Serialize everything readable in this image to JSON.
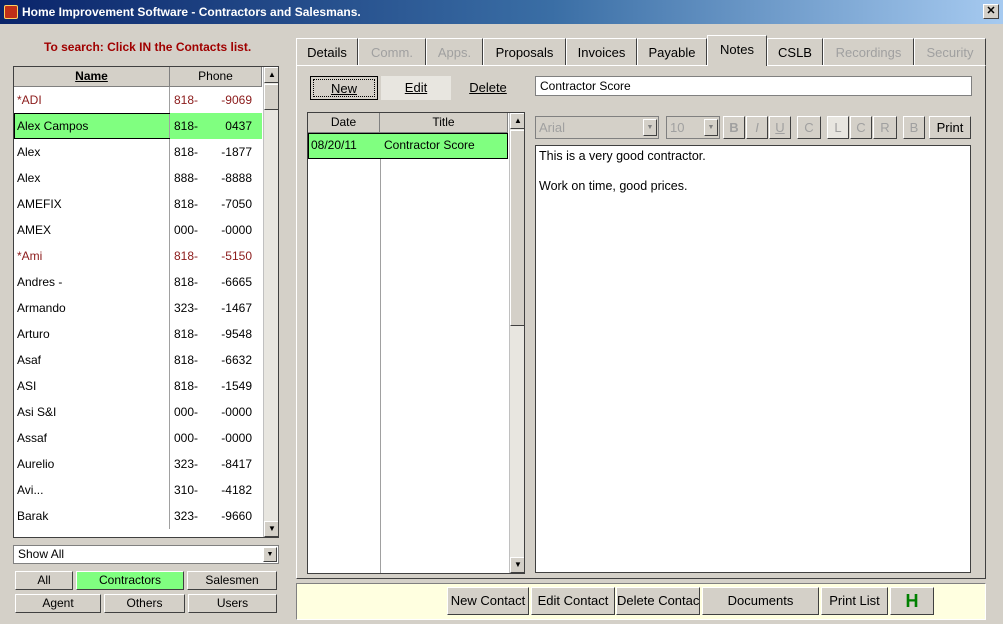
{
  "window": {
    "title": "Home Improvement Software - Contractors and Salesmans.",
    "close_glyph": "✕"
  },
  "search_hint": "To search: Click IN the Contacts list.",
  "contacts": {
    "columns": {
      "name": "Name",
      "phone": "Phone"
    },
    "rows": [
      {
        "name": "*ADI",
        "p1": "818-",
        "p2": "-9069",
        "style": "red"
      },
      {
        "name": "Alex Campos",
        "p1": "818-",
        "p2": "0437",
        "style": "sel"
      },
      {
        "name": "Alex",
        "p1": "818-",
        "p2": "-1877",
        "style": ""
      },
      {
        "name": "Alex",
        "p1": "888-",
        "p2": "-8888",
        "style": ""
      },
      {
        "name": "AMEFIX",
        "p1": "818-",
        "p2": "-7050",
        "style": ""
      },
      {
        "name": "AMEX",
        "p1": "000-",
        "p2": "-0000",
        "style": ""
      },
      {
        "name": "*Ami",
        "p1": "818-",
        "p2": "-5150",
        "style": "red"
      },
      {
        "name": "Andres -",
        "p1": "818-",
        "p2": "-6665",
        "style": ""
      },
      {
        "name": "Armando",
        "p1": "323-",
        "p2": "-1467",
        "style": ""
      },
      {
        "name": "Arturo",
        "p1": "818-",
        "p2": "-9548",
        "style": ""
      },
      {
        "name": "Asaf",
        "p1": "818-",
        "p2": "-6632",
        "style": ""
      },
      {
        "name": "ASI",
        "p1": "818-",
        "p2": "-1549",
        "style": ""
      },
      {
        "name": "Asi S&I",
        "p1": "000-",
        "p2": "-0000",
        "style": ""
      },
      {
        "name": "Assaf",
        "p1": "000-",
        "p2": "-0000",
        "style": ""
      },
      {
        "name": "Aurelio",
        "p1": "323-",
        "p2": "-8417",
        "style": ""
      },
      {
        "name": "Avi...",
        "p1": "310-",
        "p2": "-4182",
        "style": ""
      },
      {
        "name": "Barak",
        "p1": "323-",
        "p2": "-9660",
        "style": ""
      }
    ]
  },
  "filter": {
    "value": "Show All"
  },
  "type_buttons": [
    {
      "label": "All",
      "name": "all"
    },
    {
      "label": "Contractors",
      "name": "contractors"
    },
    {
      "label": "Salesmen",
      "name": "salesmen"
    },
    {
      "label": "Agent",
      "name": "agent"
    },
    {
      "label": "Others",
      "name": "others"
    },
    {
      "label": "Users",
      "name": "users"
    }
  ],
  "tabs": [
    {
      "label": "Details",
      "state": "normal"
    },
    {
      "label": "Comm.",
      "state": "disabled"
    },
    {
      "label": "Apps.",
      "state": "disabled"
    },
    {
      "label": "Proposals",
      "state": "normal"
    },
    {
      "label": "Invoices",
      "state": "normal"
    },
    {
      "label": "Payable",
      "state": "normal"
    },
    {
      "label": "Notes",
      "state": "active"
    },
    {
      "label": "CSLB",
      "state": "normal"
    },
    {
      "label": "Recordings",
      "state": "disabled"
    },
    {
      "label": "Security",
      "state": "disabled"
    }
  ],
  "notes": {
    "new_label": "New",
    "edit_label": "Edit",
    "delete_label": "Delete",
    "title_value": "Contractor Score",
    "list_columns": {
      "date": "Date",
      "title": "Title"
    },
    "items": [
      {
        "date": "08/20/11",
        "title": "Contractor Score"
      }
    ],
    "font": "Arial",
    "size": "10",
    "format_buttons": [
      "B",
      "I",
      "U",
      "C",
      "L",
      "C",
      "R",
      "B"
    ],
    "print_label": "Print",
    "body": [
      "This is a very good contractor.",
      "Work on time, good prices."
    ]
  },
  "footer": {
    "new_contact": "New Contact",
    "edit_contact": "Edit Contact",
    "delete_contact": "Delete Contact",
    "documents": "Documents",
    "print_list": "Print List",
    "h_label": "H"
  }
}
